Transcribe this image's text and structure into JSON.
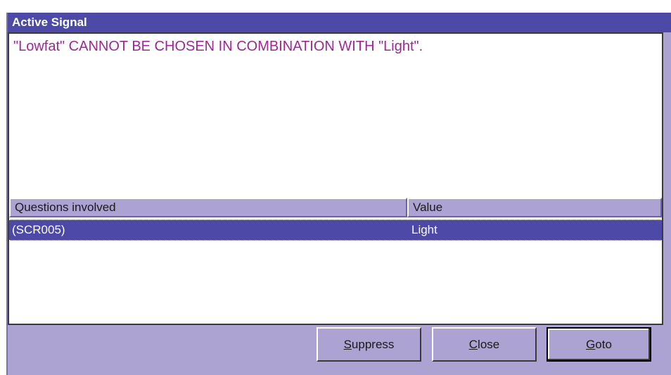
{
  "window": {
    "title": "Active Signal"
  },
  "message": {
    "text": "\"Lowfat\" CANNOT BE CHOSEN IN COMBINATION WITH \"Light\"."
  },
  "table": {
    "columns": [
      "Questions involved",
      "Value"
    ],
    "rows": [
      {
        "question": "(SCR005)",
        "value": "Light",
        "selected": true
      }
    ]
  },
  "buttons": {
    "suppress": {
      "mnemonic": "S",
      "rest": "uppress"
    },
    "close": {
      "mnemonic": "C",
      "rest": "lose"
    },
    "goto": {
      "mnemonic": "G",
      "rest": "oto"
    }
  },
  "colors": {
    "titlebar": "#4c4aa6",
    "dialog_bg": "#ada3d2",
    "message_text": "#a0249a",
    "selection": "#4c4aa6"
  }
}
